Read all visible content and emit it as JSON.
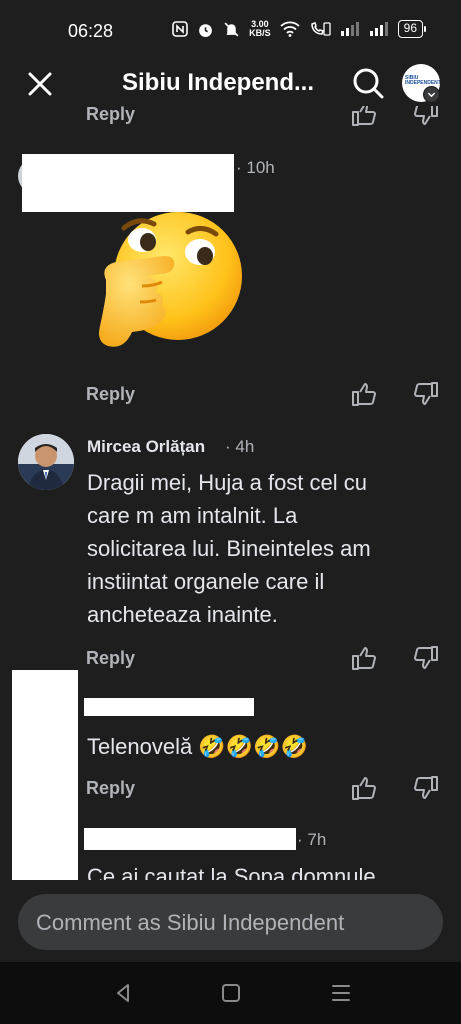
{
  "status_bar": {
    "time": "06:28",
    "net_speed_value": "3.00",
    "net_speed_unit": "KB/S",
    "battery": "96"
  },
  "header": {
    "title": "Sibiu Independ...",
    "page_avatar_text": "SIBIU INDEPENDENT"
  },
  "comments": [
    {
      "time": "· 10h",
      "reply": "Reply",
      "emoji": "thinking-face"
    },
    {
      "author": "Mircea Orlățan",
      "time": "· 4h",
      "text": [
        "Dragii mei, Huja a fost cel cu",
        "care m am intalnit. La",
        "solicitarea lui. Bineinteles am",
        "instiintat organele care il",
        "ancheteaza inainte."
      ],
      "reply": "Reply"
    },
    {
      "text": "Telenovelă 🤣🤣🤣🤣",
      "reply": "Reply"
    },
    {
      "time": "· 7h",
      "text": "Ce ai cautat la Sopa domnule"
    }
  ],
  "top_reply": "Reply",
  "composer": {
    "placeholder": "Comment as Sibiu Independent"
  },
  "colors": {
    "background": "#1e1e1f",
    "text": "#e4e6eb",
    "muted": "#b0b3b8",
    "input": "#3a3b3c"
  }
}
